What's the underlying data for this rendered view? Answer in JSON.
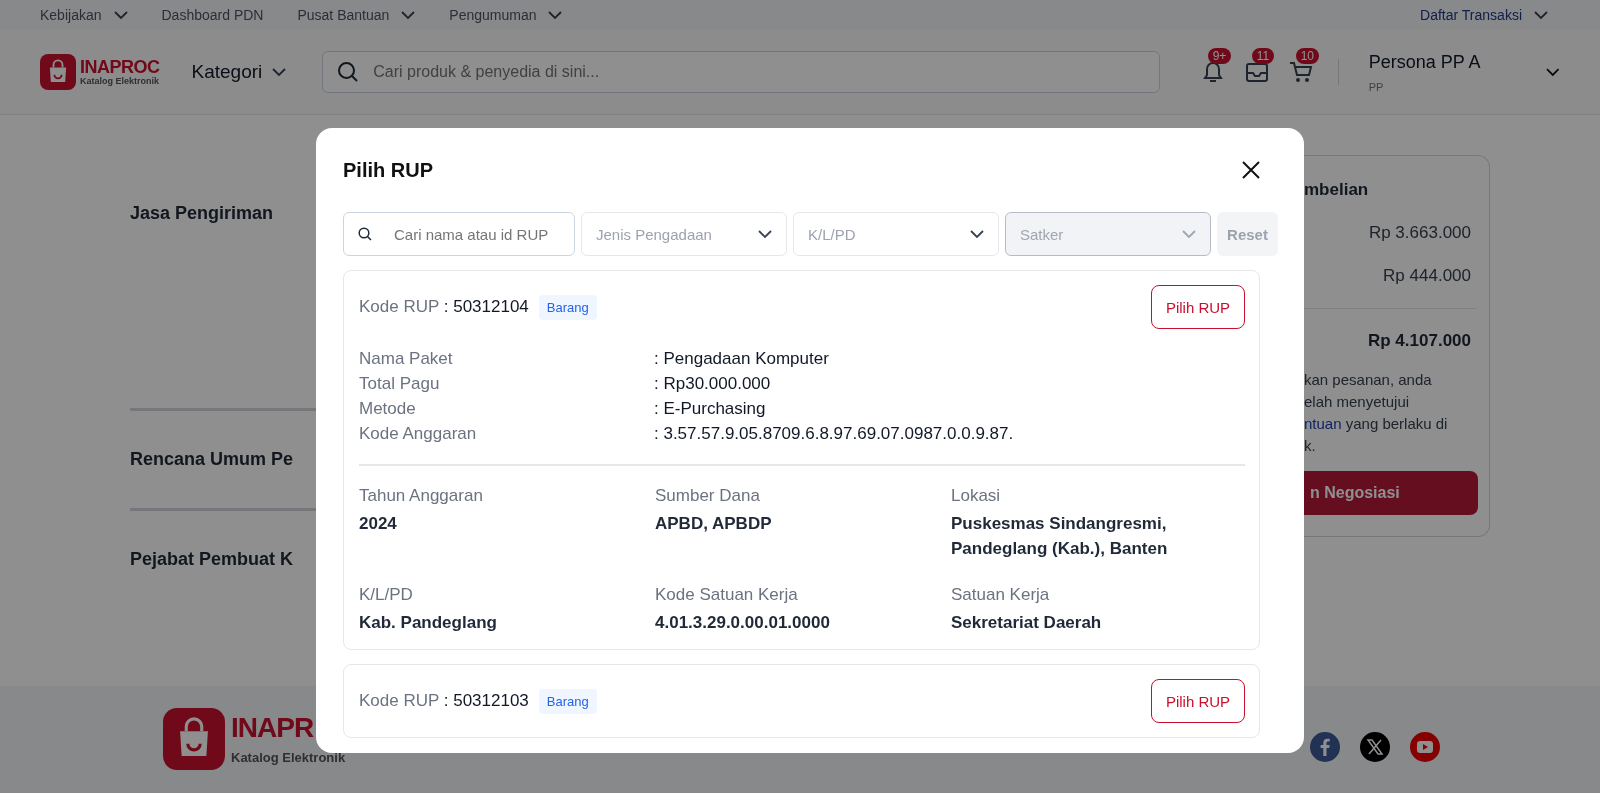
{
  "top_bar": {
    "links": [
      {
        "label": "Kebijakan",
        "dropdown": true
      },
      {
        "label": "Dashboard PDN",
        "dropdown": false
      },
      {
        "label": "Pusat Bantuan",
        "dropdown": true
      },
      {
        "label": "Pengumuman",
        "dropdown": true
      }
    ],
    "right_link": {
      "label": "Daftar Transaksi",
      "dropdown": true
    }
  },
  "header": {
    "logo": {
      "name": "INAPROC",
      "subtitle": "Katalog Elektronik"
    },
    "category": "Kategori",
    "search": {
      "placeholder": "Cari produk & penyedia di sini..."
    },
    "icons": [
      {
        "kind": "bell",
        "badge": "9+"
      },
      {
        "kind": "inbox",
        "badge": "11"
      },
      {
        "kind": "cart",
        "badge": "10"
      }
    ],
    "user": {
      "name": "Persona PP A",
      "role": "PP"
    }
  },
  "page": {
    "sections": [
      "Jasa Pengiriman",
      "Rencana Umum Pe",
      "Pejabat Pembuat K"
    ],
    "summary": {
      "title": "mbelian",
      "rows": [
        "Rp 3.663.000",
        "Rp 444.000"
      ],
      "total": "Rp 4.107.000",
      "note_lines": [
        "kan pesanan, anda",
        "elah menyetujui",
        "**ntuan** yang berlaku di",
        "k."
      ],
      "button": "n Negosiasi"
    }
  },
  "footer": {
    "logo": {
      "name": "INAPR",
      "subtitle": "Katalog Elektronik"
    },
    "socials": [
      {
        "kind": "facebook"
      },
      {
        "kind": "x"
      },
      {
        "kind": "youtube"
      }
    ]
  },
  "modal": {
    "title": "Pilih RUP",
    "search": {
      "placeholder": "Cari nama atau id RUP"
    },
    "filters": [
      {
        "placeholder": "Jenis Pengadaan",
        "disabled": false
      },
      {
        "placeholder": "K/L/PD",
        "disabled": false
      },
      {
        "placeholder": "Satker",
        "disabled": true
      }
    ],
    "reset": "Reset",
    "items": [
      {
        "code_label": "Kode RUP",
        "code": ": 50312104",
        "tag": "Barang",
        "button": "Pilih RUP",
        "details": [
          {
            "label": "Nama Paket",
            "value": ": Pengadaan Komputer"
          },
          {
            "label": "Total Pagu",
            "value": ": Rp30.000.000"
          },
          {
            "label": "Metode",
            "value": ": E-Purchasing"
          },
          {
            "label": "Kode Anggaran",
            "value": ": 3.57.57.9.05.8709.6.8.97.69.07.0987.0.0.9.87."
          }
        ],
        "facts": [
          {
            "label": "Tahun Anggaran",
            "value": "2024"
          },
          {
            "label": "Sumber Dana",
            "value": "APBD, APBDP"
          },
          {
            "label": "Lokasi",
            "value": "Puskesmas Sindangresmi, Pandeglang (Kab.), Banten"
          },
          {
            "label": "K/L/PD",
            "value": "Kab. Pandeglang"
          },
          {
            "label": "Kode Satuan Kerja",
            "value": "4.01.3.29.0.00.01.0000"
          },
          {
            "label": "Satuan Kerja",
            "value": "Sekretariat Daerah"
          }
        ]
      },
      {
        "code_label": "Kode RUP",
        "code": ": 50312103",
        "tag": "Barang",
        "button": "Pilih RUP"
      }
    ]
  }
}
